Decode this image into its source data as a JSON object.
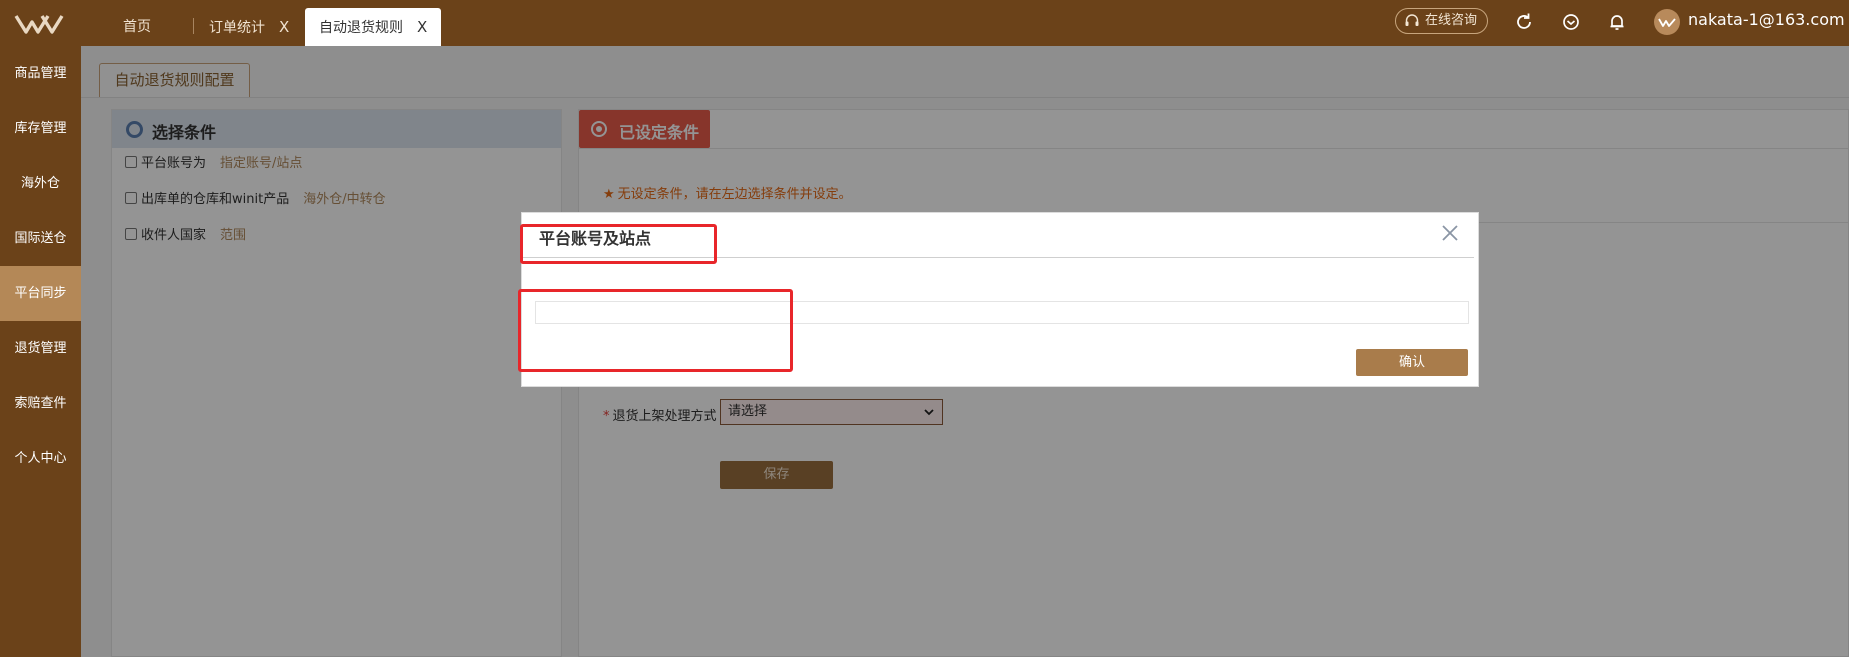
{
  "colors": {
    "brand": "#6b4219",
    "accent": "#b48857",
    "alert": "#e85c4b",
    "annotation": "#e8262a"
  },
  "tabs": [
    {
      "label": "首页",
      "closable": false,
      "active": false
    },
    {
      "label": "订单统计",
      "closable": true,
      "active": false
    },
    {
      "label": "自动退货规则",
      "closable": true,
      "active": true
    }
  ],
  "tab_close_glyph": "X",
  "header": {
    "consult_label": "在线咨询",
    "user": "nakata-1@163.com",
    "icons": [
      "refresh-icon",
      "feedback-icon",
      "bell-icon"
    ]
  },
  "sidebar": {
    "items": [
      {
        "label": "商品管理"
      },
      {
        "label": "库存管理"
      },
      {
        "label": "海外仓"
      },
      {
        "label": "国际送仓"
      },
      {
        "label": "平台同步",
        "active": true
      },
      {
        "label": "退货管理"
      },
      {
        "label": "索赔查件"
      },
      {
        "label": "个人中心"
      }
    ]
  },
  "main": {
    "config_tab": "自动退货规则配置",
    "left_title": "选择条件",
    "conditions": [
      {
        "label": "平台账号为",
        "link": "指定账号/站点"
      },
      {
        "label": "出库单的仓库和winit产品",
        "link": "海外仓/中转仓"
      },
      {
        "label": "收件人国家",
        "link": "范围"
      }
    ],
    "right_title": "已设定条件",
    "notice": "无设定条件，请在左边选择条件并设定。",
    "return_label": "退货上架处理方式",
    "return_select": "请选择",
    "save": "保存"
  },
  "modal": {
    "title": "平台账号及站点",
    "confirm": "确认"
  }
}
